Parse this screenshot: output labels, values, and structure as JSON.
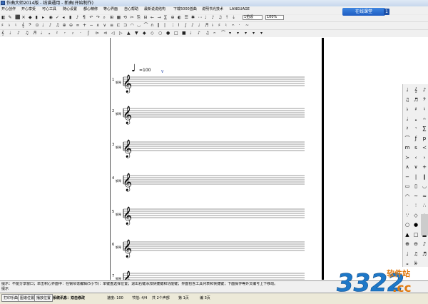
{
  "window": {
    "title": "作曲大师2014版 - 线谱通用 - 新曲(开始制作)"
  },
  "menu": [
    "开心创作",
    "开心享受",
    "可心工具",
    "随心设置",
    "都心精修",
    "等心界面",
    "自心帮助",
    "最新说说结构",
    "下载5000首曲",
    "说明书光技术",
    "LANGUAGE"
  ],
  "toolbar": {
    "row1_icons": [
      "◧",
      "✎",
      "⬛",
      "✕",
      "◆",
      "▮",
      "▸",
      "◉",
      "✓",
      "◂",
      "▮",
      "♪",
      "¶",
      "↶",
      "↷",
      "⌕",
      "⊞",
      "▦",
      "⟲",
      "✂",
      "⎘",
      "⊟",
      "←",
      "→",
      "∑",
      "⊕",
      "◐",
      "☰",
      "✱",
      "⋯",
      "♩",
      "♪",
      "♫",
      "⇡",
      "⇣"
    ],
    "measure_select": "1拍设",
    "zoom_select": "100%",
    "row2_icons": [
      "♯",
      "♭",
      "♮",
      "𝄞",
      "𝄢",
      "⊙",
      "♩",
      "♪",
      "♫",
      "⊕",
      "⊖",
      "∞",
      "+",
      "−",
      "∧",
      "∨",
      "≡",
      "⊏",
      "⊐",
      "◠",
      "◡",
      "⌒",
      "∩",
      "‖",
      "|",
      "⋮",
      "⌇",
      "∫",
      "♪",
      "♩",
      "♬",
      "♭",
      "♯",
      "♮",
      "𝄐",
      "·",
      "~"
    ],
    "row3_icons": [
      "𝄞",
      "♩",
      "♪",
      "♫",
      "♬",
      "𝅗𝅥",
      "𝅝",
      "𝄽",
      "𝄾",
      "𝄿",
      "·",
      "ʃ",
      "⊳",
      "⊲",
      "◁",
      "▷",
      "▲",
      "▼",
      "◆",
      "◇",
      "○",
      "●",
      "□",
      "■",
      "♩",
      "♪",
      "♫",
      "𝄐",
      "⌒",
      "▾",
      "▾",
      "▾",
      "▾",
      "▾"
    ]
  },
  "banner": {
    "label": "在线课堂",
    "badge": "1"
  },
  "score": {
    "tempo": "♩=100",
    "staff_label": "钢琴",
    "staff_numbers": [
      "1",
      "2",
      "3",
      "4",
      "5",
      "6",
      "7"
    ]
  },
  "palette": {
    "icons": [
      "♩",
      "𝄞",
      "♪",
      "♫",
      "♬",
      "𝄢",
      "♭",
      "♯",
      "♮",
      "𝅗𝅥",
      "𝅝",
      "𝄐",
      "𝄽",
      "𝄾",
      "∑",
      "⌒",
      "ƒ",
      "p",
      "m",
      "s",
      "≺",
      "≻",
      "‹",
      "›",
      "∧",
      "∨",
      "+",
      "−",
      "|",
      "‖",
      "▭",
      "▯",
      "◡",
      "◠",
      "~",
      "≈",
      "·",
      "∶",
      "∴",
      "∵",
      "◇",
      "◆",
      "○",
      "●",
      "△",
      "▲",
      "□",
      "■",
      "⊕",
      "⊖",
      "♪",
      "♩",
      "♫",
      "♬",
      "𝄪",
      "𝄫"
    ]
  },
  "status_message": "提示：不能分享窗口；单击积心界面中：在钢琴谱编辑(5小节)：单键盘选择位置；退出右键添加快捷键和功能键；界面包含工具列表和快捷键；下面操作等外文编号上下移动。",
  "status_message2": "提示",
  "statusbar": {
    "btn1": "打印乐曲",
    "btn2": "图谱位置",
    "btn3": "播放位置",
    "system": "系统讯息：双击修改",
    "speed": "速度: 100",
    "beat": "节拍: 4/4",
    "total": "共 2个声部",
    "current": "第 1页",
    "mode": "编 3页"
  },
  "watermark": {
    "big": "3322",
    "small_cn": "软件站",
    "small_en": ".cc"
  }
}
